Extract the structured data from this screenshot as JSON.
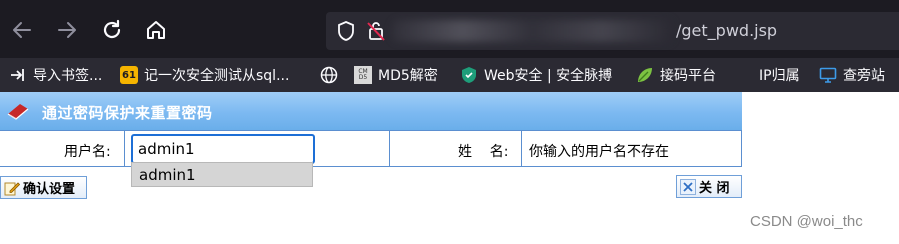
{
  "browser": {
    "url_suffix": "/get_pwd.jsp",
    "bookmarks": [
      {
        "label": "导入书签...",
        "icon": "import-icon"
      },
      {
        "label": "记一次安全测试从sql...",
        "icon": "site-61-icon"
      },
      {
        "label": "",
        "icon": "globe-icon"
      },
      {
        "label": "MD5解密",
        "icon": "cmd5-icon"
      },
      {
        "label": "Web安全 | 安全脉搏",
        "icon": "shield-icon"
      },
      {
        "label": "接码平台",
        "icon": "leaf-icon"
      },
      {
        "label": "IP归属",
        "icon": "puzzle-icon"
      },
      {
        "label": "查旁站",
        "icon": "monitor-icon"
      }
    ]
  },
  "page": {
    "title": "通过密码保护来重置密码",
    "username_label": "用户名:",
    "username_value": "admin1",
    "autocomplete_suggestion": "admin1",
    "name_label": "姓    名:",
    "name_message": "你输入的用户名不存在",
    "confirm_button": "确认设置",
    "close_button": "关 闭"
  },
  "watermark": "CSDN @woi_thc",
  "colors": {
    "toolbar": "#1c1b22",
    "bookmarks_bar": "#2b2a33",
    "title_bar": "#7cb9f1",
    "table_border": "#5b8fd0",
    "input_focus": "#1d6fd6"
  }
}
